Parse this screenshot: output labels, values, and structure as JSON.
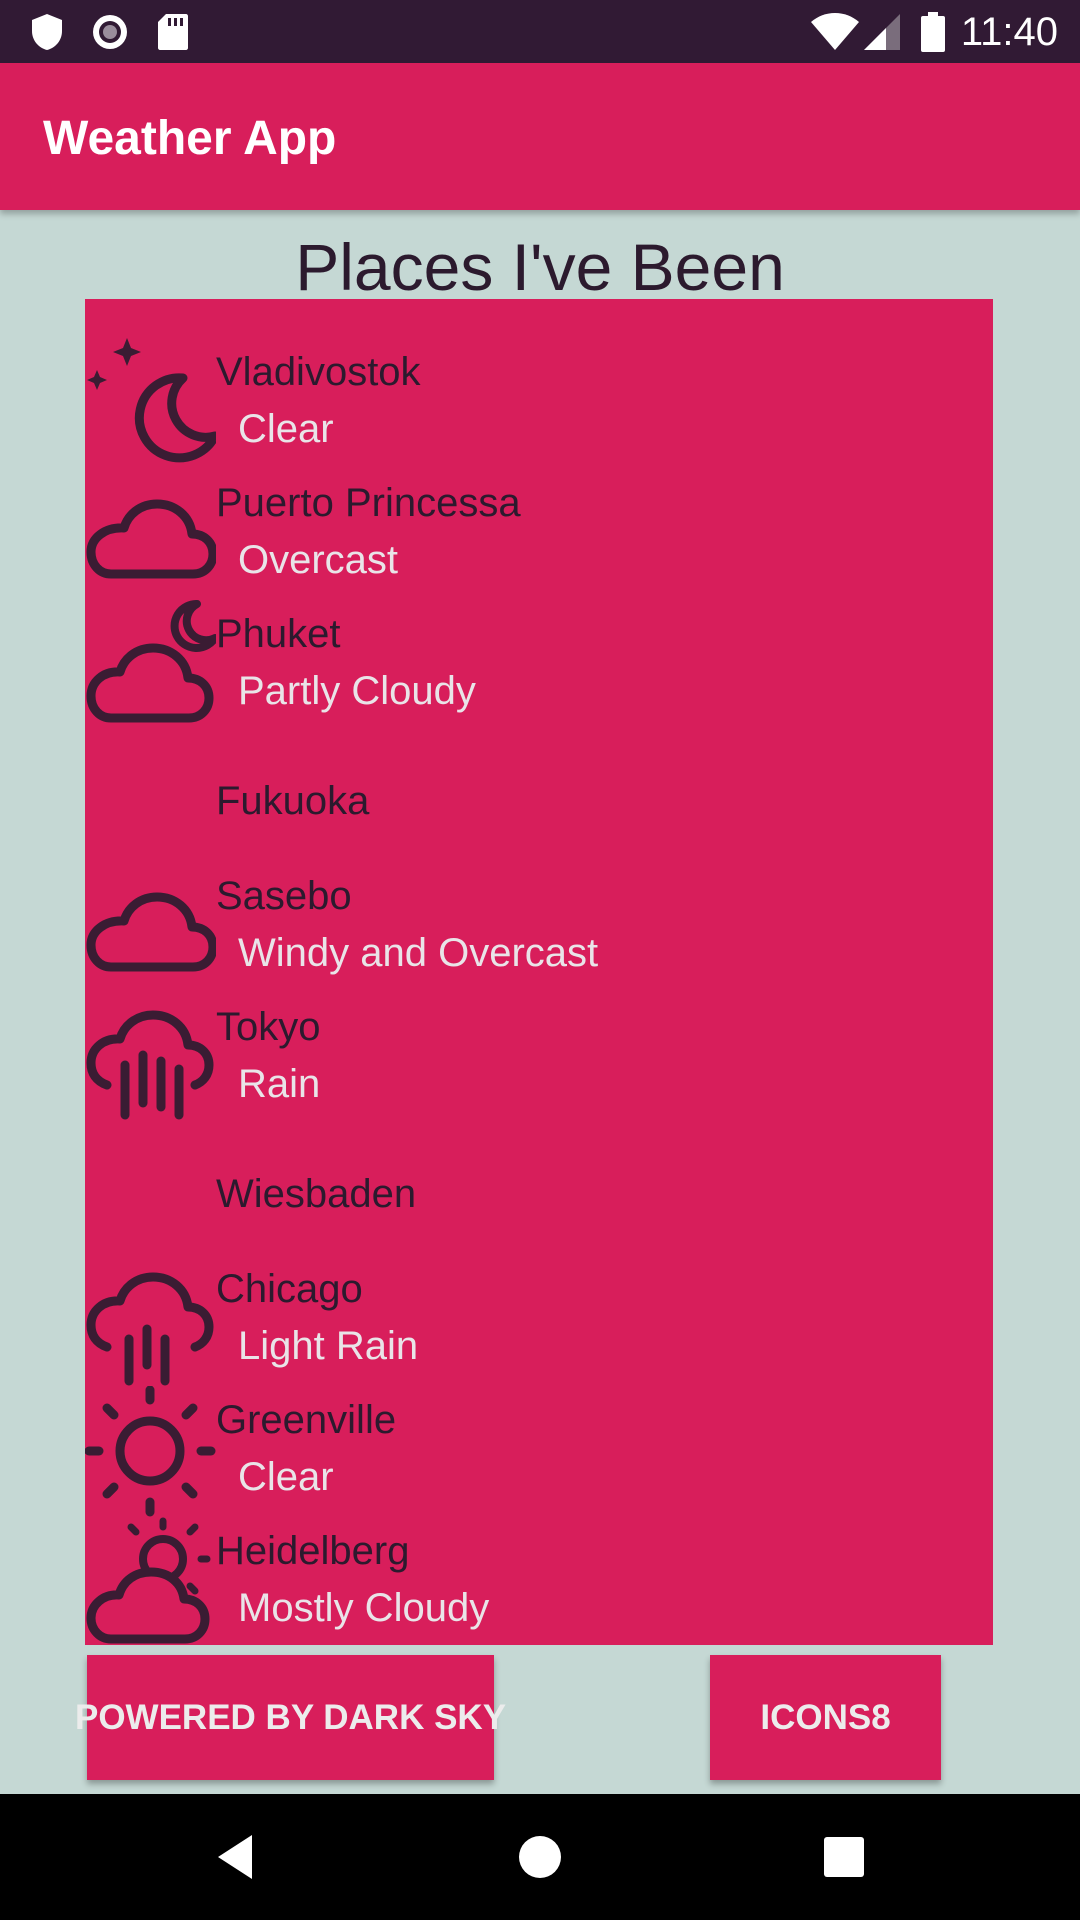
{
  "status_bar": {
    "time": "11:40",
    "icons": [
      "shield-icon",
      "record-icon",
      "sd-card-icon",
      "wifi-icon",
      "signal-icon",
      "battery-icon"
    ]
  },
  "app_bar": {
    "title": "Weather App"
  },
  "heading": "Places I've Been",
  "places": [
    {
      "city": "Vladivostok",
      "summary": "Clear",
      "icon": "clear-night-icon"
    },
    {
      "city": "Puerto Princessa",
      "summary": "Overcast",
      "icon": "cloud-icon"
    },
    {
      "city": "Phuket",
      "summary": "Partly Cloudy",
      "icon": "partly-cloudy-night-icon"
    },
    {
      "city": "Fukuoka",
      "summary": "",
      "icon": ""
    },
    {
      "city": "Sasebo",
      "summary": "Windy and Overcast",
      "icon": "cloud-icon"
    },
    {
      "city": "Tokyo",
      "summary": "Rain",
      "icon": "rain-icon"
    },
    {
      "city": "Wiesbaden",
      "summary": "",
      "icon": ""
    },
    {
      "city": "Chicago",
      "summary": "Light Rain",
      "icon": "light-rain-icon"
    },
    {
      "city": "Greenville",
      "summary": "Clear",
      "icon": "sun-icon"
    },
    {
      "city": "Heidelberg",
      "summary": "Mostly Cloudy",
      "icon": "partly-cloudy-day-icon"
    }
  ],
  "buttons": {
    "darksky": "POWERED BY DARK SKY",
    "icons8": "ICONS8"
  },
  "colors": {
    "primary": "#d81e5b",
    "status_bar": "#311a34",
    "background": "#c5d8d4",
    "text_dark": "#2c1a2e",
    "text_light": "#e9e4e8"
  },
  "nav_bar": [
    "back-icon",
    "home-icon",
    "recents-icon"
  ]
}
